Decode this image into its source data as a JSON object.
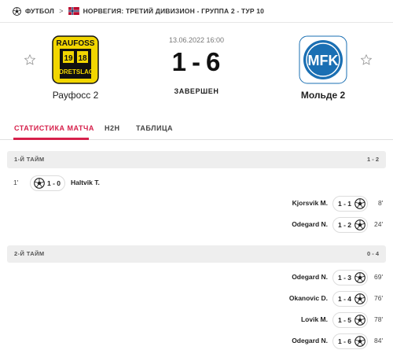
{
  "breadcrumb": {
    "sport": "ФУТБОЛ",
    "league": "НОРВЕГИЯ: ТРЕТИЙ ДИВИЗИОН - ГРУППА 2 - ТУР 10",
    "sport_icon": "soccer-ball-icon",
    "flag_icon": "norway-flag-icon",
    "separator": ">"
  },
  "match": {
    "date": "13.06.2022 16:00",
    "home_score": "1",
    "away_score": "6",
    "score_separator": "-",
    "status": "ЗАВЕРШЕН",
    "home_team": "Рауфосс 2",
    "away_team": "Мольде 2",
    "home_logo_text": "RAUFOSS",
    "away_logo_text": "MFK"
  },
  "tabs": [
    {
      "label": "СТАТИСТИКА МАТЧА",
      "active": true
    },
    {
      "label": "H2H",
      "active": false
    },
    {
      "label": "ТАБЛИЦА",
      "active": false
    }
  ],
  "periods": [
    {
      "label": "1-Й ТАЙМ",
      "score": "1 - 2",
      "events": [
        {
          "side": "home",
          "minute": "1'",
          "player": "Haltvik T.",
          "score": "1 - 0"
        },
        {
          "side": "away",
          "minute": "8'",
          "player": "Kjorsvik M.",
          "score": "1 - 1"
        },
        {
          "side": "away",
          "minute": "24'",
          "player": "Odegard N.",
          "score": "1 - 2"
        }
      ]
    },
    {
      "label": "2-Й ТАЙМ",
      "score": "0 - 4",
      "events": [
        {
          "side": "away",
          "minute": "69'",
          "player": "Odegard N.",
          "score": "1 - 3"
        },
        {
          "side": "away",
          "minute": "76'",
          "player": "Okanovic D.",
          "score": "1 - 4"
        },
        {
          "side": "away",
          "minute": "78'",
          "player": "Lovik M.",
          "score": "1 - 5"
        },
        {
          "side": "away",
          "minute": "84'",
          "player": "Odegard N.",
          "score": "1 - 6"
        }
      ]
    }
  ],
  "colors": {
    "accent": "#d6204b",
    "home_logo_yellow": "#f2d600",
    "home_logo_black": "#111111",
    "away_logo_blue": "#1a6fb3",
    "period_bg": "#eeeeee"
  },
  "icons": {
    "goal": "soccer-ball-icon",
    "favorite": "star-outline-icon"
  }
}
